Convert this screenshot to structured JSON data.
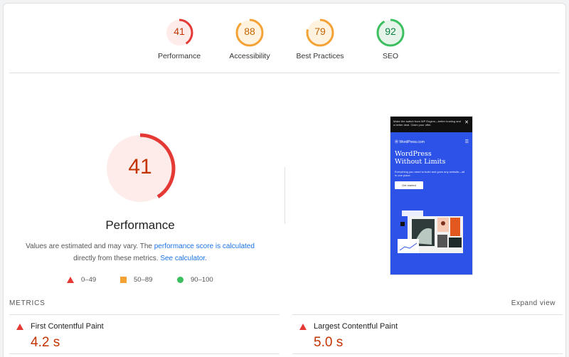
{
  "colors": {
    "fail": "#e53935",
    "fail_bg": "#fdecea",
    "fail_text": "#c33300",
    "average": "#f4a235",
    "average_bg": "#fff3e0",
    "average_text": "#c26500",
    "pass": "#3bbf5f",
    "pass_bg": "#e6f4ea",
    "pass_text": "#0d8043",
    "link": "#1a73e8"
  },
  "gauges": [
    {
      "label": "Performance",
      "score": 41,
      "tone": "fail"
    },
    {
      "label": "Accessibility",
      "score": 88,
      "tone": "average"
    },
    {
      "label": "Best Practices",
      "score": 79,
      "tone": "average"
    },
    {
      "label": "SEO",
      "score": 92,
      "tone": "pass"
    }
  ],
  "performance": {
    "score": 41,
    "title": "Performance",
    "desc_1": "Values are estimated and may vary. The ",
    "desc_link_1": "performance score is calculated",
    "desc_2": "directly from these metrics. ",
    "desc_link_2": "See calculator."
  },
  "legend": {
    "fail": "0–49",
    "average": "50–89",
    "pass": "90–100"
  },
  "screenshot": {
    "banner": "Make the switch from WP Engine—better hosting and a better deal. Claim your offer.",
    "close": "✕",
    "brand": "WordPress.com",
    "menu": "☰",
    "headline_1": "WordPress",
    "headline_2": "Without Limits",
    "subtext": "Everything you need to build and grow any website—all in one place.",
    "cta": "Get started"
  },
  "metrics": {
    "section_label": "METRICS",
    "expand_label": "Expand view",
    "items": [
      {
        "name": "First Contentful Paint",
        "value": "4.2 s"
      },
      {
        "name": "Largest Contentful Paint",
        "value": "5.0 s"
      }
    ]
  }
}
